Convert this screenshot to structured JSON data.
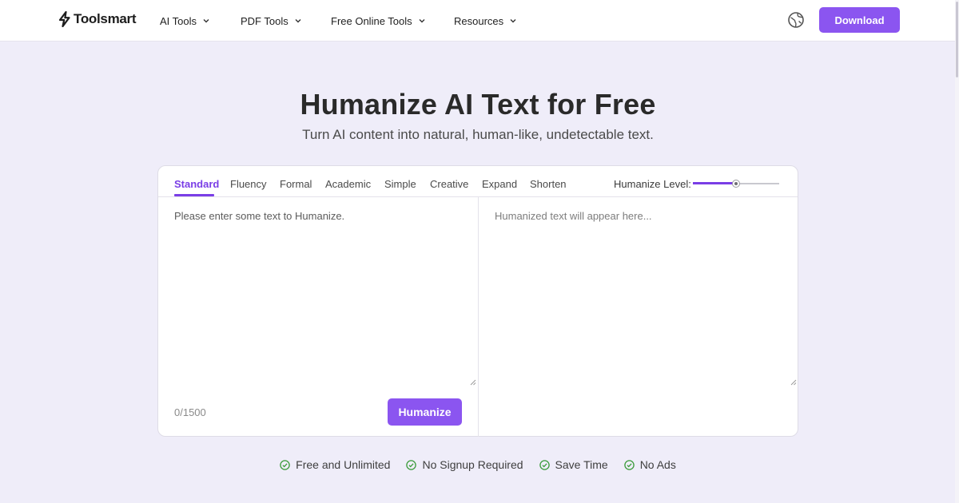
{
  "header": {
    "logo_text": "Toolsmart",
    "nav": [
      {
        "label": "AI Tools"
      },
      {
        "label": "PDF Tools"
      },
      {
        "label": "Free Online Tools"
      },
      {
        "label": "Resources"
      }
    ],
    "download_label": "Download"
  },
  "hero": {
    "title": "Humanize AI Text for Free",
    "subtitle": "Turn AI content into natural, human-like, undetectable text."
  },
  "tool": {
    "tabs": [
      {
        "label": "Standard",
        "active": true
      },
      {
        "label": "Fluency"
      },
      {
        "label": "Formal"
      },
      {
        "label": "Academic"
      },
      {
        "label": "Simple"
      },
      {
        "label": "Creative"
      },
      {
        "label": "Expand"
      },
      {
        "label": "Shorten"
      }
    ],
    "level_label": "Humanize Level:",
    "level_value": 0.5,
    "input_value": "",
    "input_placeholder": "Please enter some text to Humanize.",
    "output_placeholder": "Humanized text will appear here...",
    "char_count": "0/1500",
    "humanize_label": "Humanize"
  },
  "features": [
    {
      "label": "Free and Unlimited"
    },
    {
      "label": "No Signup Required"
    },
    {
      "label": "Save Time"
    },
    {
      "label": "No Ads"
    }
  ],
  "colors": {
    "accent": "#8b55f0",
    "active_tab": "#7a3ee6",
    "page_bg": "#efedf9",
    "check": "#3a9b3a"
  },
  "icons": {
    "logo": "lightning-bolt-icon",
    "nav_chevron": "chevron-down-icon",
    "language": "globe-icon",
    "feature": "check-circle-icon"
  }
}
